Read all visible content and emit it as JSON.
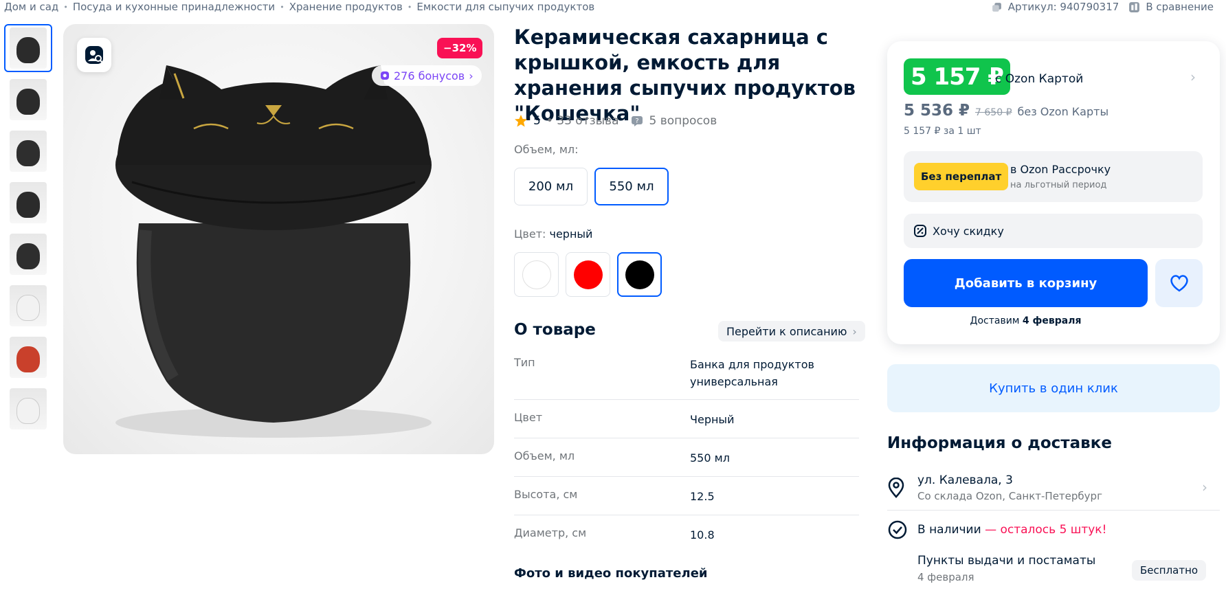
{
  "breadcrumbs": [
    "Дом и сад",
    "Посуда и кухонные принадлежности",
    "Хранение продуктов",
    "Емкости для сыпучих продуктов"
  ],
  "article": "Артикул: 940790317",
  "compare_label": "В сравнение",
  "gallery": {
    "discount_badge": "−32%",
    "bonus": "276 бонусов",
    "thumbnails": [
      "front",
      "back",
      "open-top",
      "paw-bottom",
      "lid-off",
      "set-of-two",
      "red-and-black",
      "scoop"
    ]
  },
  "product": {
    "title": "Керамическая сахарница с крышкой, емкость для хранения сыпучих продуктов \"Кошечка\"",
    "rating": "5",
    "reviews": "• 33 отзыва",
    "questions": "5 вопросов",
    "volume_label": "Объем, мл:",
    "volume_options": [
      "200 мл",
      "550 мл"
    ],
    "color_label": "Цвет:",
    "color_value": "черный",
    "color_options": [
      {
        "name": "white",
        "hex": "#ffffff"
      },
      {
        "name": "red",
        "hex": "#ff0000"
      },
      {
        "name": "black",
        "hex": "#000000"
      }
    ]
  },
  "about": {
    "heading": "О товаре",
    "goto_description": "Перейти к описанию",
    "specs": [
      {
        "key": "Тип",
        "value": "Банка для продуктов универсальная"
      },
      {
        "key": "Цвет",
        "value": "Черный"
      },
      {
        "key": "Объем, мл",
        "value": "550 мл"
      },
      {
        "key": "Высота, см",
        "value": "12.5"
      },
      {
        "key": "Диаметр, см",
        "value": "10.8"
      }
    ],
    "photos_heading": "Фото и видео покупателей"
  },
  "pricing": {
    "card_price": "5 157 ₽",
    "card_label": "с Ozon Картой",
    "regular_price": "5 536 ₽",
    "old_price": "7 650 ₽",
    "regular_label": "без Ozon Карты",
    "per_unit": "5 157 ₽ за 1 шт",
    "install_badge": "Без переплат",
    "install_title": "в Ozon Рассрочку",
    "install_sub": "на льготный период",
    "want_discount": "Хочу скидку",
    "add_to_cart": "Добавить в корзину",
    "deliver_prefix": "Доставим",
    "deliver_date": "4 февраля",
    "one_click": "Купить в один клик"
  },
  "delivery": {
    "heading": "Информация о доставке",
    "address": "ул. Калевала, 3",
    "warehouse": "Со склада Ozon, Санкт-Петербург",
    "in_stock": "В наличии",
    "stock_left": "— осталось 5 штук!",
    "pickup": "Пункты выдачи и постаматы",
    "pickup_date": "4 февраля",
    "pickup_price": "Бесплатно"
  },
  "colors": {
    "accent": "#005bff",
    "green": "#10c44c",
    "sale": "#f91155",
    "bonus": "#7b45f6",
    "yellow": "#ffd02c"
  }
}
